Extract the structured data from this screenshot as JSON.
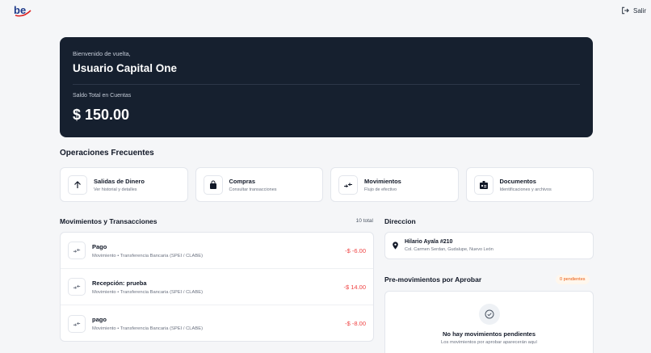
{
  "topbar": {
    "logo_icon": "brand-logo-icon",
    "logout_icon": "logout-icon",
    "logout_label": "Salir"
  },
  "hero": {
    "welcome": "Bienvenido de vuelta,",
    "user_name": "Usuario Capital One",
    "balance_label": "Saldo Total en Cuentas",
    "balance_value": "$ 150.00"
  },
  "operations": {
    "title": "Operaciones Frecuentes",
    "items": [
      {
        "icon": "arrow-up-icon",
        "title": "Salidas de Dinero",
        "subtitle": "Ver historial y detalles"
      },
      {
        "icon": "shopping-bag-icon",
        "title": "Compras",
        "subtitle": "Consultar transacciones"
      },
      {
        "icon": "transfer-arrows-icon",
        "title": "Movimientos",
        "subtitle": "Flujo de efectivo"
      },
      {
        "icon": "id-card-icon",
        "title": "Documentos",
        "subtitle": "Identificaciones y archivos"
      }
    ]
  },
  "transactions": {
    "title": "Movimientos y Transacciones",
    "count": "10 total",
    "items": [
      {
        "icon": "transfer-arrows-icon",
        "title": "Pago",
        "subtitle": "Movimiento • Transferencia Bancaria (SPEI / CLABE)",
        "amount": "-$ -6.00"
      },
      {
        "icon": "transfer-arrows-icon",
        "title": "Recepción: prueba",
        "subtitle": "Movimiento • Transferencia Bancaria (SPEI / CLABE)",
        "amount": "-$ 14.00"
      },
      {
        "icon": "transfer-arrows-icon",
        "title": "pago",
        "subtitle": "Movimiento • Transferencia Bancaria (SPEI / CLABE)",
        "amount": "-$ -8.00"
      }
    ]
  },
  "address": {
    "title": "Direccion",
    "icon": "map-pin-icon",
    "line1": "Hilario Ayala #210",
    "line2": "Col. Carmen Serdan, Gudalupe, Nuevo León"
  },
  "pending": {
    "title": "Pre-movimientos por Aprobar",
    "badge": "0 pendientes",
    "icon": "check-circle-icon",
    "empty_title": "No hay movimientos pendientes",
    "empty_sub": "Los movimientos por aprobar aparecerán aquí"
  },
  "colors": {
    "hero_bg": "#16202f",
    "negative_amount": "#ef4444",
    "badge_text": "#ea580c",
    "brand_blue": "#1e3a8a",
    "brand_red": "#dc2626"
  }
}
